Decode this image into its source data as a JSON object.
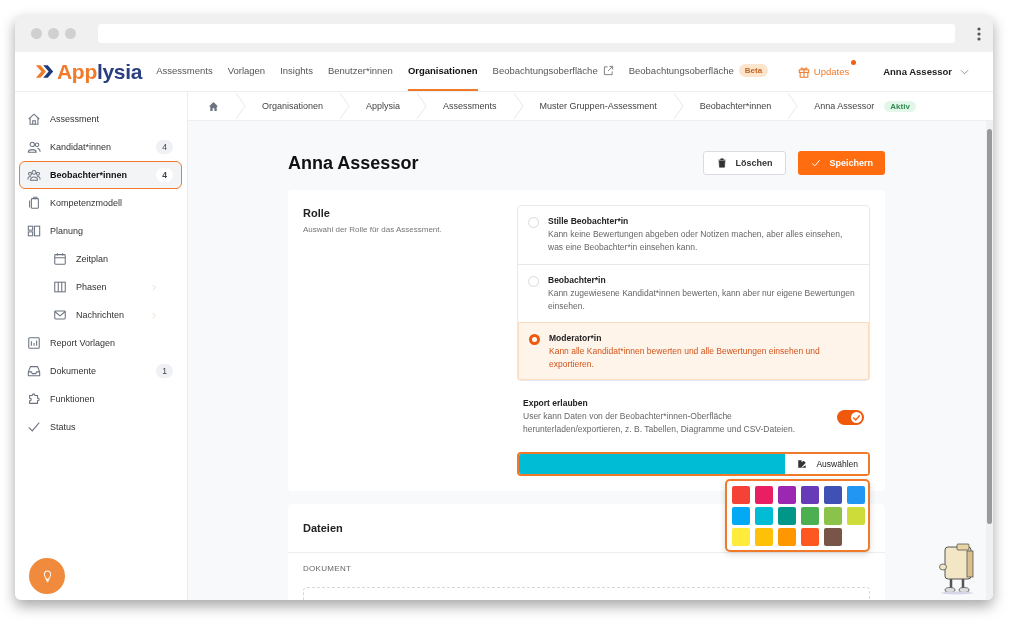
{
  "header": {
    "brand_parts": [
      "App",
      "lysia"
    ],
    "nav": [
      {
        "label": "Assessments",
        "selected": false,
        "kind": "plain"
      },
      {
        "label": "Vorlagen",
        "selected": false,
        "kind": "plain"
      },
      {
        "label": "Insights",
        "selected": false,
        "kind": "plain"
      },
      {
        "label": "Benutzer*innen",
        "selected": false,
        "kind": "plain"
      },
      {
        "label": "Organisationen",
        "selected": true,
        "kind": "plain"
      },
      {
        "label": "Beobachtungsoberfläche",
        "selected": false,
        "kind": "external"
      },
      {
        "label": "Beobachtungsoberfläche",
        "selected": false,
        "kind": "badge",
        "badge": "Beta"
      }
    ],
    "updates": {
      "label": "Updates",
      "unread": true
    },
    "user": {
      "name": "Anna Assessor"
    }
  },
  "sidebar": {
    "items": [
      {
        "label": "Assessment",
        "selected": false
      },
      {
        "label": "Kandidat*innen",
        "selected": false,
        "badge": "4"
      },
      {
        "label": "Beobachter*innen",
        "selected": true,
        "badge": "4"
      },
      {
        "label": "Kompetenzmodell",
        "selected": false
      },
      {
        "label": "Planung",
        "selected": false,
        "children": [
          {
            "label": "Zeitplan",
            "selected": false,
            "submenu": false
          },
          {
            "label": "Phasen",
            "selected": false,
            "submenu": true
          },
          {
            "label": "Nachrichten",
            "selected": false,
            "submenu": true
          }
        ]
      },
      {
        "label": "Report Vorlagen",
        "selected": false
      },
      {
        "label": "Dokumente",
        "selected": false,
        "badge": "1"
      },
      {
        "label": "Funktionen",
        "selected": false
      },
      {
        "label": "Status",
        "selected": false
      }
    ]
  },
  "breadcrumb": {
    "items": [
      "Organisationen",
      "Applysia",
      "Assessments",
      "Muster Gruppen-Assessment",
      "Beobachter*innen",
      "Anna Assessor"
    ],
    "status": "Aktiv"
  },
  "page": {
    "title": "Anna Assessor",
    "delete_button": "Löschen",
    "save_button": "Speichern"
  },
  "role_section": {
    "title": "Rolle",
    "description": "Auswahl der Rolle für das Assessment.",
    "options": [
      {
        "title": "Stille Beobachter*in",
        "description": "Kann keine Bewertungen abgeben oder Notizen machen, aber alles einsehen, was eine Beobachter*in einsehen kann.",
        "selected": false
      },
      {
        "title": "Beobachter*in",
        "description": "Kann zugewiesene Kandidat*innen bewerten, kann aber nur eigene Bewertungen einsehen.",
        "selected": false
      },
      {
        "title": "Moderator*in",
        "description": "Kann alle Kandidat*innen bewerten und alle Bewertungen einsehen und exportieren.",
        "selected": true
      }
    ],
    "export": {
      "title": "Export erlauben",
      "description": "User kann Daten von der Beobachter*innen-Oberfläche herunterladen/exportieren, z. B. Tabellen, Diagramme und CSV-Dateien.",
      "on": true
    },
    "color_field": {
      "color": "#00bcd4",
      "button": "Auswählen"
    }
  },
  "color_picker": {
    "open": true,
    "swatches": [
      {
        "color": "#f44336"
      },
      {
        "color": "#e91e63"
      },
      {
        "color": "#9c27b0"
      },
      {
        "color": "#673ab7"
      },
      {
        "color": "#3f51b5"
      },
      {
        "color": "#2196f3"
      },
      {
        "color": "#03a9f4"
      },
      {
        "color": "#00bcd4"
      },
      {
        "color": "#009688"
      },
      {
        "color": "#4caf50"
      },
      {
        "color": "#8bc34a"
      },
      {
        "color": "#cddc39"
      },
      {
        "color": "#ffeb3b"
      },
      {
        "color": "#ffc107"
      },
      {
        "color": "#ff9800"
      },
      {
        "color": "#ff5722"
      },
      {
        "color": "#795548"
      }
    ]
  },
  "files_section": {
    "title": "Dateien",
    "column": "DOKUMENT"
  }
}
